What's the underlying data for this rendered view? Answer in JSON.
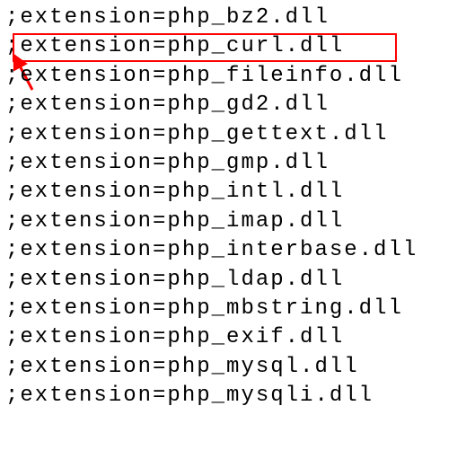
{
  "lines": [
    ";extension=php_bz2.dll",
    ";extension=php_curl.dll",
    ";extension=php_fileinfo.dll",
    ";extension=php_gd2.dll",
    ";extension=php_gettext.dll",
    ";extension=php_gmp.dll",
    ";extension=php_intl.dll",
    ";extension=php_imap.dll",
    ";extension=php_interbase.dll",
    ";extension=php_ldap.dll",
    ";extension=php_mbstring.dll",
    ";extension=php_exif.dll",
    ";extension=php_mysql.dll",
    ";extension=php_mysqli.dll"
  ],
  "highlight_index": 1,
  "highlight_color": "#ff0000"
}
